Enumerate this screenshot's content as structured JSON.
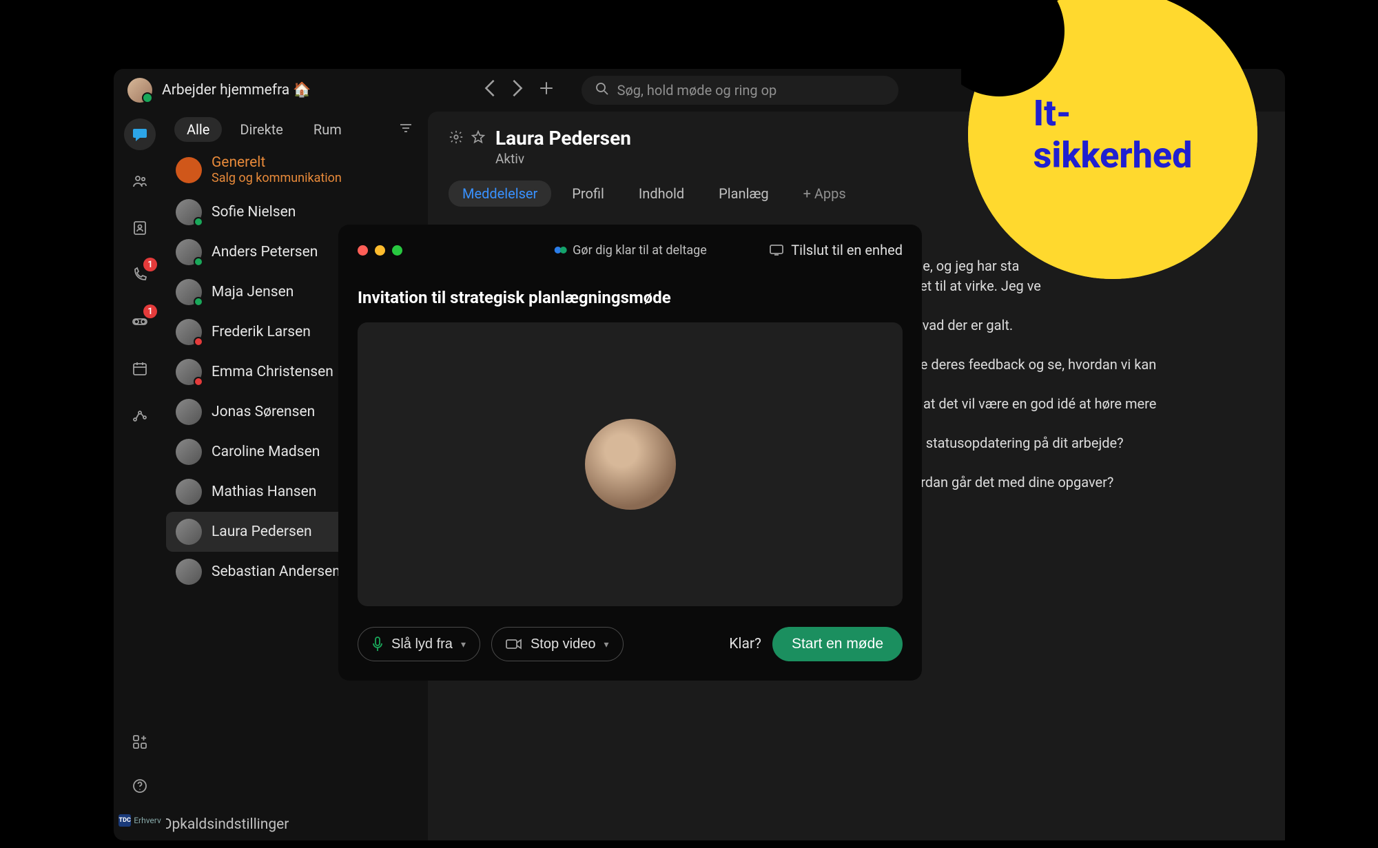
{
  "header": {
    "status": "Arbejder hjemmefra 🏠",
    "search_placeholder": "Søg, hold møde og ring op"
  },
  "rail": {
    "phone_badge": "1",
    "voicemail_badge": "1",
    "brand": "Erhverv"
  },
  "sidebar": {
    "filters": {
      "all": "Alle",
      "direct": "Direkte",
      "rooms": "Rum"
    },
    "general": {
      "name": "Generelt",
      "sub": "Salg og kommunikation"
    },
    "contacts": [
      {
        "name": "Sofie Nielsen",
        "presence": "green"
      },
      {
        "name": "Anders Petersen",
        "presence": "green"
      },
      {
        "name": "Maja Jensen",
        "presence": "green"
      },
      {
        "name": "Frederik Larsen",
        "presence": "red"
      },
      {
        "name": "Emma Christensen",
        "presence": "red"
      },
      {
        "name": "Jonas Sørensen",
        "presence": ""
      },
      {
        "name": "Caroline Madsen",
        "presence": ""
      },
      {
        "name": "Mathias Hansen",
        "presence": ""
      },
      {
        "name": "Laura Pedersen",
        "presence": ""
      },
      {
        "name": "Sebastian Andersen",
        "presence": ""
      }
    ],
    "call_settings": "Opkaldsindstillinger"
  },
  "main": {
    "title": "Laura Pedersen",
    "status": "Aktiv",
    "tabs": {
      "messages": "Meddelelser",
      "profile": "Profil",
      "content": "Indhold",
      "schedule": "Planlæg",
      "apps": "+   Apps"
    },
    "messages": [
      "n uge, og jeg har sta",
      "få det til at virke. Jeg ve",
      "af, hvad der er galt.",
      "utere deres feedback og se, hvordan vi kan",
      "tror, at det vil være en god idé at høre mere",
      "g en statusopdatering på dit arbejde?",
      "Hvordan går det med dine opgaver?"
    ]
  },
  "modal": {
    "ready_banner": "Gør dig klar til at deltage",
    "connect_device": "Tilslut til en enhed",
    "title": "Invitation til strategisk planlægningsmøde",
    "mute": "Slå lyd fra",
    "stop_video": "Stop video",
    "ready": "Klar?",
    "start": "Start en møde"
  },
  "badge": {
    "text": "It-sikkerhed"
  }
}
